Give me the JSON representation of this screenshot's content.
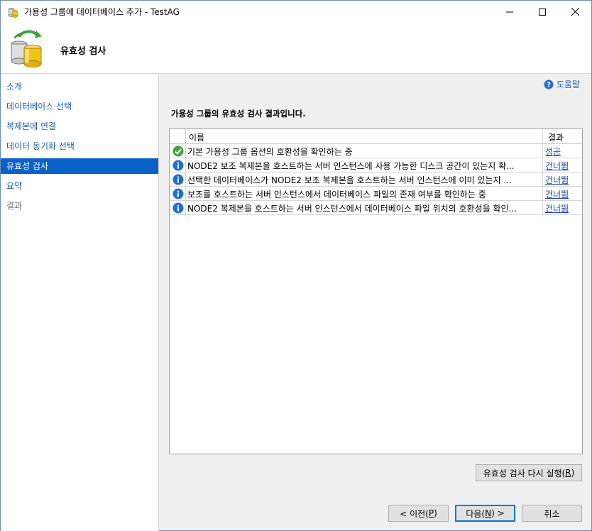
{
  "window": {
    "title": "가용성 그룹에 데이터베이스 추가 - TestAG",
    "minimize_icon": "minimize-icon",
    "maximize_icon": "maximize-icon",
    "close_icon": "close-icon"
  },
  "header": {
    "title": "유효성 검사",
    "icon": "database-sync-icon"
  },
  "sidebar": {
    "items": [
      {
        "label": "소개",
        "state": "normal"
      },
      {
        "label": "데이터베이스 선택",
        "state": "normal"
      },
      {
        "label": "복제본에 연결",
        "state": "normal"
      },
      {
        "label": "데이터 동기화 선택",
        "state": "normal"
      },
      {
        "label": "유효성 검사",
        "state": "active"
      },
      {
        "label": "요약",
        "state": "normal"
      },
      {
        "label": "결과",
        "state": "disabled"
      }
    ]
  },
  "help": {
    "label": "도움말",
    "icon": "help-icon"
  },
  "main": {
    "intro": "가용성 그룹의 유효성 검사 결과입니다.",
    "columns": {
      "name": "이름",
      "result": "결과"
    },
    "rows": [
      {
        "icon": "success-icon",
        "name": "기본 가용성 그룹 옵션의 호환성을 확인하는 중",
        "result": "성공"
      },
      {
        "icon": "info-icon",
        "name": "NODE2 보조 복제본을 호스트하는 서버 인스턴스에 사용 가능한 디스크 공간이 있는지 확...",
        "result": "건너뜀"
      },
      {
        "icon": "info-icon",
        "name": "선택한 데이터베이스가 NODE2 보조 복제본을 호스트하는 서버 인스턴스에 이미 있는지 ...",
        "result": "건너뜀"
      },
      {
        "icon": "info-icon",
        "name": "보조를 호스트하는 서버 인스턴스에서 데이터베이스 파일의 존재 여부를 확인하는 중",
        "result": "건너뜀"
      },
      {
        "icon": "info-icon",
        "name": "NODE2 복제본을 호스트하는 서버 인스턴스에서 데이터베이스 파일 위치의 호환성을 확인...",
        "result": "건너뜀"
      }
    ]
  },
  "buttons": {
    "rerun_prefix": "유효성 검사 다시 실행(",
    "rerun_key": "R",
    "rerun_suffix": ")",
    "prev_prefix": "< 이전(",
    "prev_key": "P",
    "prev_suffix": ")",
    "next_prefix": "다음(",
    "next_key": "N",
    "next_suffix": ") >",
    "cancel": "취소"
  },
  "colors": {
    "accent": "#0a62c9",
    "link": "#1c5fa8",
    "success": "#3fa33f",
    "info": "#1e6fd0"
  }
}
